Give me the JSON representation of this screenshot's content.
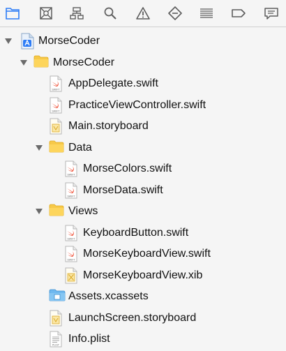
{
  "toolbar": {
    "tabs": [
      {
        "name": "project-navigator-icon",
        "active": true
      },
      {
        "name": "source-control-icon"
      },
      {
        "name": "symbol-navigator-icon"
      },
      {
        "name": "find-navigator-icon"
      },
      {
        "name": "issue-navigator-icon"
      },
      {
        "name": "test-navigator-icon"
      },
      {
        "name": "debug-navigator-icon"
      },
      {
        "name": "breakpoint-navigator-icon"
      },
      {
        "name": "report-navigator-icon"
      }
    ],
    "accent": "#2d7cf6",
    "icon_color": "#5c5c5c"
  },
  "tree": [
    {
      "label": "MorseCoder",
      "icon": "project-icon",
      "depth": 0,
      "disclosure": "open"
    },
    {
      "label": "MorseCoder",
      "icon": "folder-icon",
      "depth": 1,
      "disclosure": "open"
    },
    {
      "label": "AppDelegate.swift",
      "icon": "swift-file-icon",
      "depth": 2
    },
    {
      "label": "PracticeViewController.swift",
      "icon": "swift-file-icon",
      "depth": 2
    },
    {
      "label": "Main.storyboard",
      "icon": "storyboard-file-icon",
      "depth": 2
    },
    {
      "label": "Data",
      "icon": "folder-icon",
      "depth": 2,
      "disclosure": "open"
    },
    {
      "label": "MorseColors.swift",
      "icon": "swift-file-icon",
      "depth": 3
    },
    {
      "label": "MorseData.swift",
      "icon": "swift-file-icon",
      "depth": 3
    },
    {
      "label": "Views",
      "icon": "folder-icon",
      "depth": 2,
      "disclosure": "open"
    },
    {
      "label": "KeyboardButton.swift",
      "icon": "swift-file-icon",
      "depth": 3
    },
    {
      "label": "MorseKeyboardView.swift",
      "icon": "swift-file-icon",
      "depth": 3
    },
    {
      "label": "MorseKeyboardView.xib",
      "icon": "xib-file-icon",
      "depth": 3
    },
    {
      "label": "Assets.xcassets",
      "icon": "asset-catalog-icon",
      "depth": 2
    },
    {
      "label": "LaunchScreen.storyboard",
      "icon": "storyboard-file-icon",
      "depth": 2
    },
    {
      "label": "Info.plist",
      "icon": "plist-file-icon",
      "depth": 2
    }
  ],
  "swift_badge": "SWIFT",
  "plist_badge": "PLIST"
}
